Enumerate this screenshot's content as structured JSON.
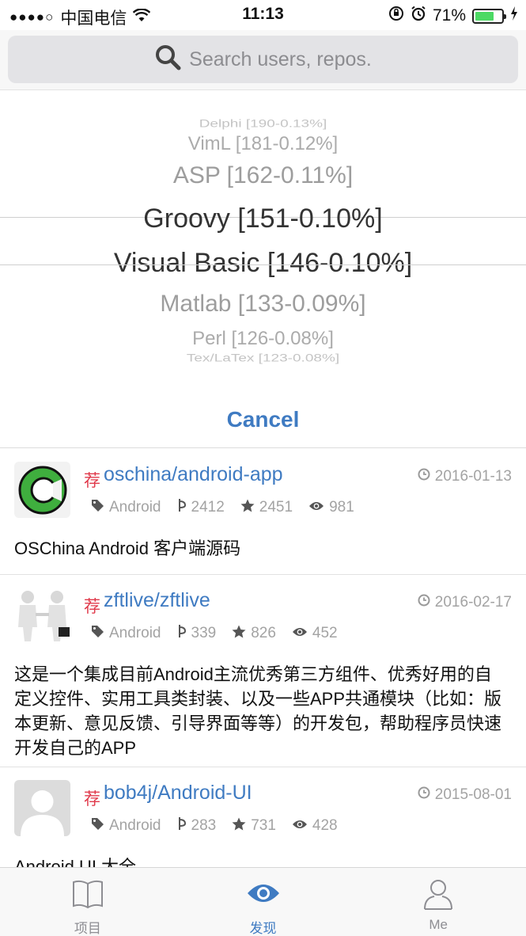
{
  "status_bar": {
    "carrier": "中国电信",
    "time": "11:13",
    "battery": "71%",
    "battery_level": 0.71
  },
  "search": {
    "placeholder": "Search users, repos."
  },
  "picker": {
    "items": [
      "Delphi [190-0.13%]",
      "VimL [181-0.12%]",
      "ASP [162-0.11%]",
      "Groovy [151-0.10%]",
      "Visual Basic [146-0.10%]",
      "Matlab [133-0.09%]",
      "Perl [126-0.08%]",
      "Tex/LaTex [123-0.08%]"
    ],
    "cancel_label": "Cancel"
  },
  "repos": [
    {
      "rec_label": "荐",
      "name": "oschina/android-app",
      "date": "2016-01-13",
      "language": "Android",
      "forks": "2412",
      "stars": "2451",
      "watchers": "981",
      "description": "OSChina Android 客户端源码"
    },
    {
      "rec_label": "荐",
      "name": "zftlive/zftlive",
      "date": "2016-02-17",
      "language": "Android",
      "forks": "339",
      "stars": "826",
      "watchers": "452",
      "description": "这是一个集成目前Android主流优秀第三方组件、优秀好用的自定义控件、实用工具类封装、以及一些APP共通模块（比如：版本更新、意见反馈、引导界面等等）的开发包，帮助程序员快速开发自己的APP"
    },
    {
      "rec_label": "荐",
      "name": "bob4j/Android-UI",
      "date": "2015-08-01",
      "language": "Android",
      "forks": "283",
      "stars": "731",
      "watchers": "428",
      "description": "Android UI 大全"
    }
  ],
  "tabs": [
    {
      "label": "项目",
      "icon": "book-icon"
    },
    {
      "label": "发现",
      "icon": "eye-icon"
    },
    {
      "label": "Me",
      "icon": "person-icon"
    }
  ],
  "colors": {
    "accent": "#3f7bc2",
    "recommend": "#e0394a",
    "battery": "#4cd964"
  }
}
